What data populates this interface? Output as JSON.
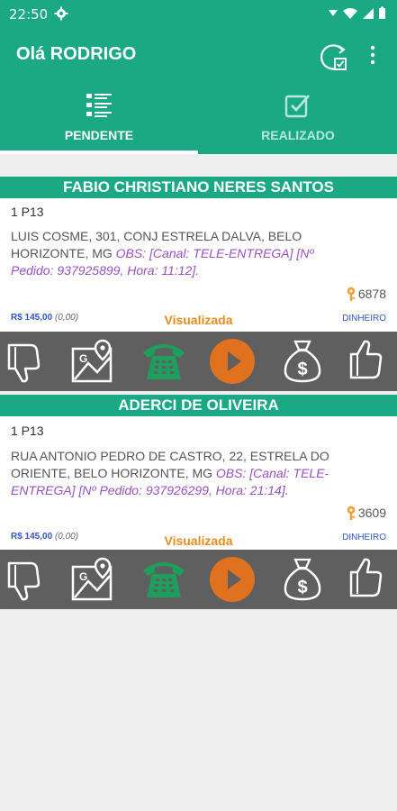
{
  "status_bar": {
    "time": "22:50"
  },
  "app_bar": {
    "title": "Olá RODRIGO"
  },
  "tabs": [
    {
      "label": "PENDENTE",
      "selected": true
    },
    {
      "label": "REALIZADO",
      "selected": false
    }
  ],
  "orders": [
    {
      "customer": "FABIO CHRISTIANO NERES SANTOS",
      "code": "1 P13",
      "address": "LUIS COSME, 301, CONJ ESTRELA DALVA, BELO HORIZONTE, MG",
      "obs_label": "OBS:",
      "obs_text": "[Canal: TELE-ENTREGA] [Nº Pedido: 937925899, Hora: 11:12].",
      "key_number": "6878",
      "price": "R$ 145,00",
      "extra": "(0,00)",
      "status": "Visualizada",
      "payment": "DINHEIRO"
    },
    {
      "customer": "ADERCI DE OLIVEIRA",
      "code": "1 P13",
      "address": "RUA ANTONIO PEDRO DE CASTRO, 22, ESTRELA DO ORIENTE, BELO HORIZONTE, MG",
      "obs_label": "OBS:",
      "obs_text": "[Canal: TELE-ENTREGA] [Nº Pedido: 937926299, Hora: 21:14].",
      "key_number": "3609",
      "price": "R$ 145,00",
      "extra": "(0,00)",
      "status": "Visualizada",
      "payment": "DINHEIRO"
    }
  ],
  "colors": {
    "primary": "#1ba885",
    "action_bar": "#5f5f5f",
    "phone_green": "#1e9e5c",
    "play_orange": "#e0711e",
    "status_orange": "#e88c1c",
    "key_gold": "#f0a030",
    "price_blue": "#2e56c8",
    "obs_purple": "#9a4fc2"
  },
  "action_icons": [
    "thumbs-down-icon",
    "map-icon",
    "phone-icon",
    "play-icon",
    "money-bag-icon",
    "thumbs-up-icon"
  ]
}
